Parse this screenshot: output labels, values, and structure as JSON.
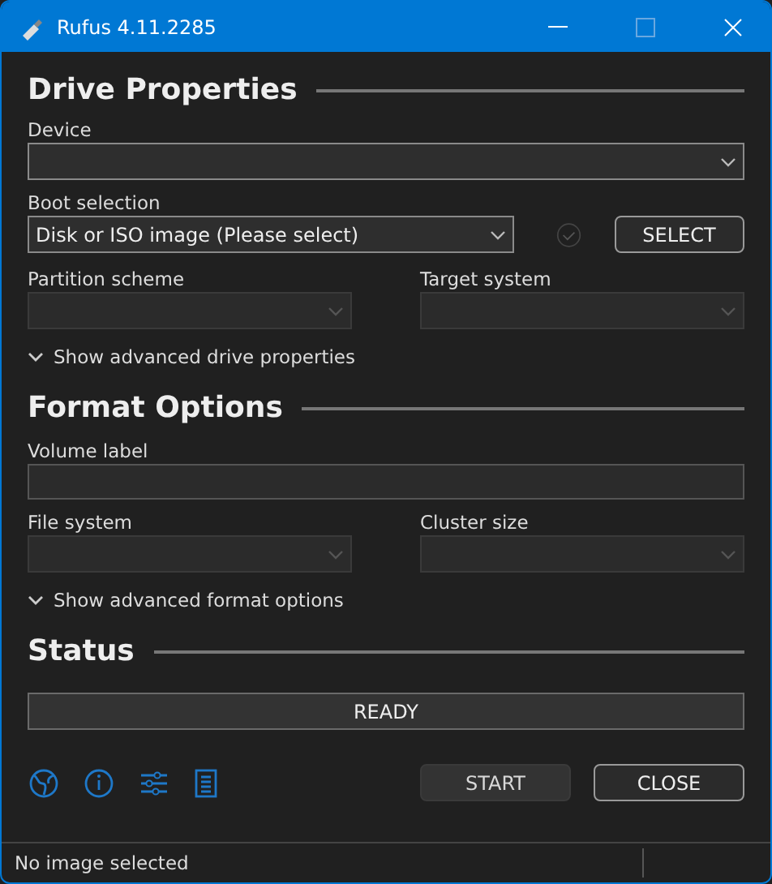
{
  "window": {
    "title": "Rufus 4.11.2285"
  },
  "drive_properties": {
    "heading": "Drive Properties",
    "device": {
      "label": "Device",
      "disabled": false
    },
    "boot_selection": {
      "label": "Boot selection",
      "value": "Disk or ISO image (Please select)",
      "disabled": false
    },
    "select_button": "SELECT",
    "partition_scheme": {
      "label": "Partition scheme",
      "disabled": true
    },
    "target_system": {
      "label": "Target system",
      "disabled": true
    },
    "advanced": {
      "label": "Show advanced drive properties",
      "expanded": false
    }
  },
  "format_options": {
    "heading": "Format Options",
    "volume_label": {
      "label": "Volume label"
    },
    "file_system": {
      "label": "File system",
      "disabled": true
    },
    "cluster_size": {
      "label": "Cluster size",
      "disabled": true
    },
    "advanced": {
      "label": "Show advanced format options",
      "expanded": false
    }
  },
  "status": {
    "heading": "Status",
    "progress": {
      "text": "READY"
    }
  },
  "toolbar": [
    {
      "kind": "globe"
    },
    {
      "kind": "info"
    },
    {
      "kind": "settings"
    },
    {
      "kind": "log"
    }
  ],
  "buttons": [
    {
      "label": "START",
      "disabled": true
    },
    {
      "label": "CLOSE",
      "disabled": false
    }
  ],
  "status_bar": {
    "text": "No image selected"
  }
}
